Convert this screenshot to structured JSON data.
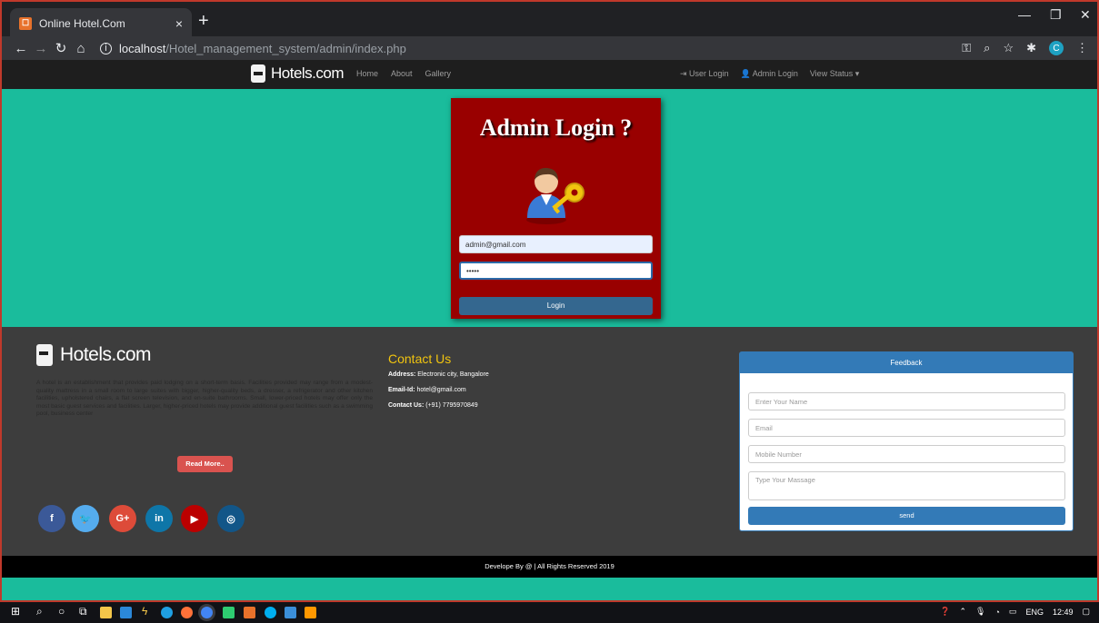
{
  "browser": {
    "tab_title": "Online Hotel.Com",
    "tab_close": "×",
    "new_tab": "+",
    "url_host": "localhost",
    "url_path": "/Hotel_management_system/admin/index.php",
    "profile_initial": "C"
  },
  "site_nav": {
    "brand": "Hotels.com",
    "links": [
      "Home",
      "About",
      "Gallery"
    ],
    "user_login": "User Login",
    "admin_login": "Admin Login",
    "view_status": "View Status ▾"
  },
  "login": {
    "title": "Admin Login ?",
    "email_value": "admin@gmail.com",
    "password_value": "•••••",
    "button_label": "Login"
  },
  "footer": {
    "brand": "Hotels.com",
    "description": "A hotel is an establishment that provides paid lodging on a short-term basis. Facilities provided may range from a modest-quality mattress in a small room to large suites with bigger, higher-quality beds, a dresser, a refrigerator and other kitchen facilities, upholstered chairs, a flat screen television, and en-suite bathrooms. Small, lower-priced hotels may offer only the most basic guest services and facilities. Larger, higher-priced hotels may provide additional guest facilities such as a swimming pool, business center",
    "read_more": "Read More..",
    "social": [
      {
        "glyph": "f",
        "color": "#3b5998"
      },
      {
        "glyph": "🐦",
        "color": "#55acee"
      },
      {
        "glyph": "G+",
        "color": "#dd4b39"
      },
      {
        "glyph": "in",
        "color": "#0e76a8"
      },
      {
        "glyph": "▶",
        "color": "#bb0000"
      },
      {
        "glyph": "◎",
        "color": "#125688"
      }
    ],
    "contact": {
      "title": "Contact Us",
      "address_label": "Address:",
      "address_value": "Electronic city, Bangalore",
      "email_label": "Email-Id:",
      "email_value": "hotel@gmail.com",
      "phone_label": "Contact Us:",
      "phone_value": "(+91) 7795970849"
    },
    "feedback": {
      "header": "Feedback",
      "name_placeholder": "Enter Your Name",
      "email_placeholder": "Email",
      "mobile_placeholder": "Mobile Number",
      "message_placeholder": "Type Your Massage",
      "send_label": "send"
    },
    "copyright": "Develope By @ | All Rights Reserved 2019"
  },
  "taskbar": {
    "lang": "ENG",
    "time": "12:49"
  },
  "colors": {
    "teal": "#1abc9c",
    "login_card": "#990000",
    "footer_bg": "#3d3d3d",
    "contact_title": "#f1c40f",
    "primary_blue": "#337ab7"
  }
}
